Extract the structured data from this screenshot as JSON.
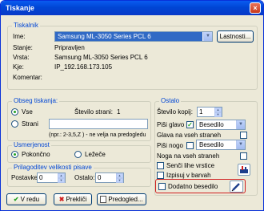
{
  "window": {
    "title": "Tiskanje",
    "close_glyph": "×"
  },
  "printer": {
    "group_title": "Tiskalnik",
    "name_label": "Ime:",
    "name_value": "Samsung ML-3050 Series PCL 6",
    "properties_button": "Lastnosti...",
    "status_label": "Stanje:",
    "status_value": "Pripravljen",
    "type_label": "Vrsta:",
    "type_value": "Samsung ML-3050 Series PCL 6",
    "where_label": "Kje:",
    "where_value": "IP_192.168.173.105",
    "comment_label": "Komentar:",
    "comment_value": ""
  },
  "range": {
    "group_title": "Obseg tiskanja:",
    "all_label": "Vse",
    "pages_count_label": "Število strani:",
    "pages_count_value": "1",
    "pages_label": "Strani",
    "pages_value": "",
    "hint": "(npr.: 2-3,5,Z ) - ne velja na predogledu"
  },
  "orientation": {
    "group_title": "Usmerjenost",
    "portrait_label": "Pokončno",
    "landscape_label": "Ležeče"
  },
  "adjust": {
    "group_title": "Prilagoditev velikosti pisave",
    "settings_label": "Postavke:",
    "settings_value": "0",
    "rest_label": "Ostalo:",
    "rest_value": "0"
  },
  "other": {
    "group_title": "Ostalo",
    "copies_label": "Število kopij:",
    "copies_value": "1",
    "header_label": "Piši glavo",
    "header_font": "Besedilo",
    "header_all_label": "Glava na vseh straneh",
    "footer_label": "Piši nogo",
    "footer_font": "Besedilo",
    "footer_all_label": "Noga na vseh straneh",
    "shade_label": "Senči lihe vrstice",
    "colors_label": "Izpisuj v barvah",
    "extra_text_label": "Dodatno besedilo"
  },
  "buttons": {
    "print_label": "V redu",
    "cancel_label": "Prekliči",
    "preview_label": "Predogled..."
  },
  "colors": {
    "title_bar": "#0046d5",
    "accent_blue": "#0046d5",
    "check_green": "#21a121",
    "highlight_red": "#d02020"
  }
}
